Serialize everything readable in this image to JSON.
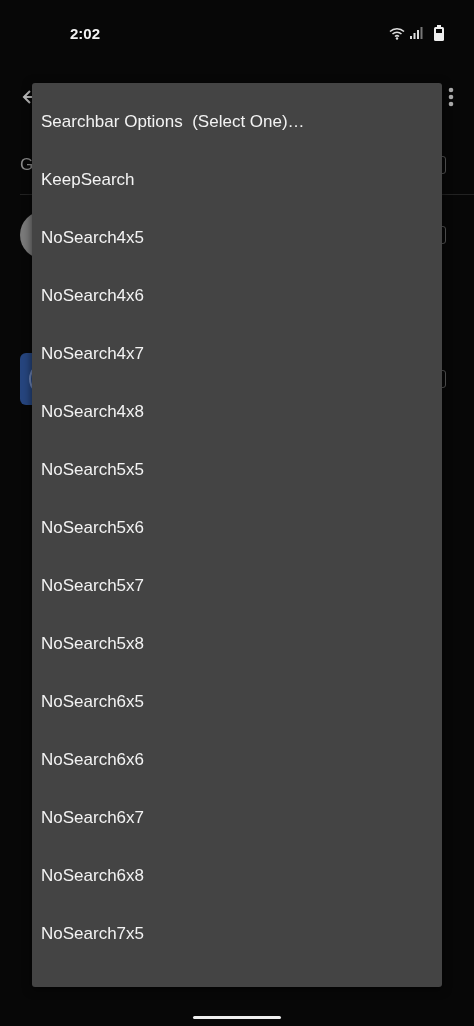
{
  "status_bar": {
    "time": "2:02"
  },
  "background": {
    "section_letter": "G",
    "checkboxes": [
      {
        "checked": false
      },
      {
        "checked": false
      },
      {
        "checked": false
      }
    ]
  },
  "menu": {
    "title": "Searchbar Options  (Select One)…",
    "items": [
      {
        "label": "KeepSearch"
      },
      {
        "label": "NoSearch4x5"
      },
      {
        "label": "NoSearch4x6"
      },
      {
        "label": "NoSearch4x7"
      },
      {
        "label": "NoSearch4x8"
      },
      {
        "label": "NoSearch5x5"
      },
      {
        "label": "NoSearch5x6"
      },
      {
        "label": "NoSearch5x7"
      },
      {
        "label": "NoSearch5x8"
      },
      {
        "label": "NoSearch6x5"
      },
      {
        "label": "NoSearch6x6"
      },
      {
        "label": "NoSearch6x7"
      },
      {
        "label": "NoSearch6x8"
      },
      {
        "label": "NoSearch7x5"
      }
    ]
  }
}
